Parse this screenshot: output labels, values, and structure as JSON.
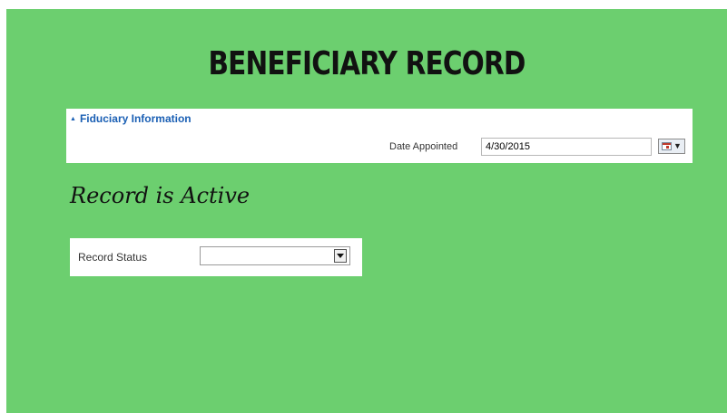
{
  "slide": {
    "background": "#6ccf6f",
    "title": "BENEFICIARY RECORD",
    "status_heading": "Record is Active"
  },
  "fiduciary_section": {
    "header": "Fiduciary Information",
    "header_color": "#1a5fb4",
    "date_label": "Date Appointed",
    "date_value": "4/30/2015"
  },
  "record_status": {
    "label": "Record Status",
    "selected_value": ""
  }
}
